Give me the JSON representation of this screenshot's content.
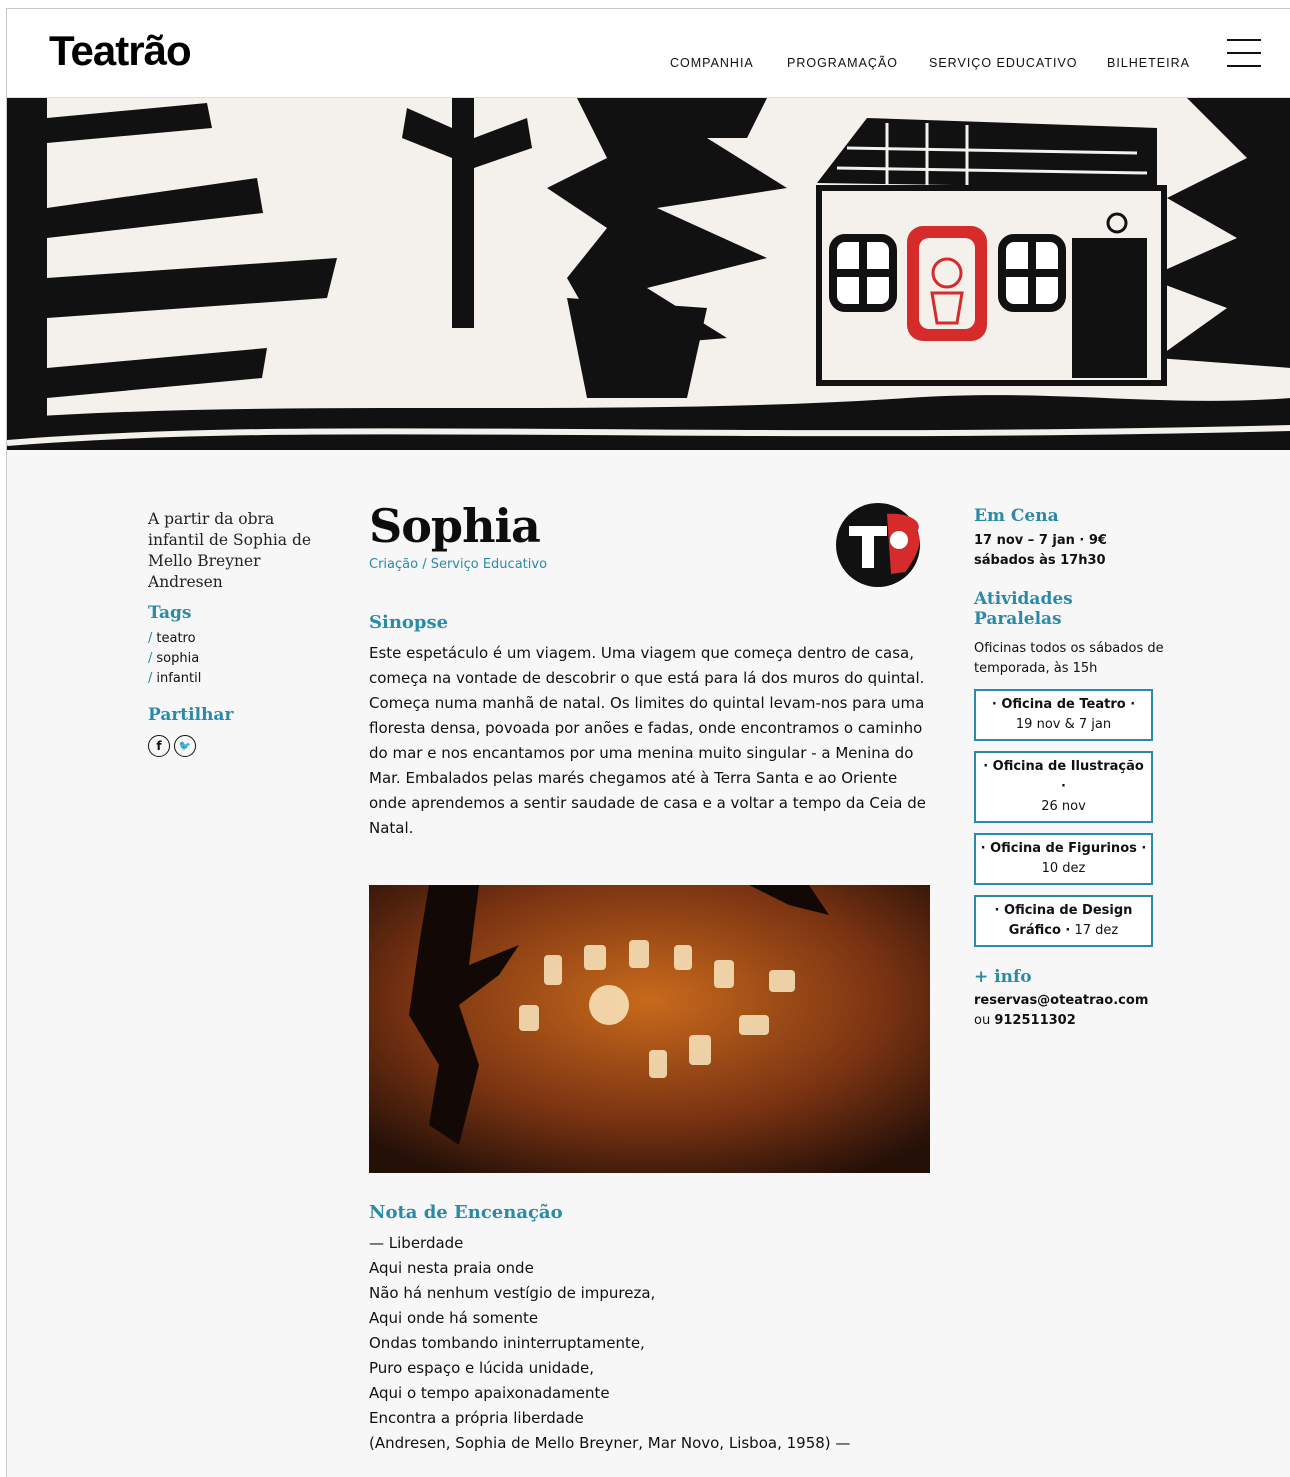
{
  "header": {
    "logo": "Teatrão",
    "nav": [
      {
        "label": "COMPANHIA"
      },
      {
        "label": "PROGRAMAÇÃO"
      },
      {
        "label": "SERVIÇO EDUCATIVO"
      },
      {
        "label": "BILHETEIRA"
      }
    ]
  },
  "left": {
    "subtitle": "A partir da obra infantil de Sophia de Mello Breyner Andresen",
    "tags_heading": "Tags",
    "tags": [
      "teatro",
      "sophia",
      "infantil"
    ],
    "share_heading": "Partilhar",
    "share": [
      {
        "icon": "facebook-icon",
        "glyph": "f"
      },
      {
        "icon": "twitter-icon",
        "glyph": "🐦"
      }
    ]
  },
  "main": {
    "title": "Sophia",
    "category": "Criação / Serviço Educativo",
    "synopsis_heading": "Sinopse",
    "synopsis": "Este espetáculo é um viagem. Uma viagem que começa dentro de casa, começa na vontade de descobrir o que está para lá dos muros do quintal. Começa numa manhã de natal. Os limites do quintal levam-nos para uma floresta densa, povoada por anões e fadas, onde encontramos o caminho do mar e nos encantamos por uma menina muito singular - a Menina do Mar. Embalados pelas marés chegamos até à Terra Santa e ao Oriente onde aprendemos a sentir saudade de casa e a voltar a tempo da Ceia de Natal.",
    "note_heading": "Nota de Encenação",
    "poem": [
      "— Liberdade",
      "Aqui nesta praia onde",
      "Não há nenhum vestígio de impureza,",
      "Aqui onde há somente",
      "Ondas tombando ininterruptamente,",
      "Puro espaço e lúcida unidade,",
      "Aqui o tempo apaixonadamente",
      "Encontra a própria liberdade",
      "(Andresen, Sophia de Mello Breyner, Mar Novo, Lisboa, 1958) —"
    ]
  },
  "right": {
    "em_cena_heading": "Em Cena",
    "dates_line1": "17 nov – 7 jan · 9€",
    "dates_line2": "sábados às 17h30",
    "activities_heading": "Atividades Paralelas",
    "activities_intro": "Oficinas todos os sábados de temporada, às 15h",
    "workshops": [
      {
        "name": "· Oficina de Teatro ·",
        "date": "19 nov & 7 jan"
      },
      {
        "name": "· Oficina de Ilustração ·",
        "date": "26 nov"
      },
      {
        "name": "· Oficina de Figurinos ·",
        "date": "10 dez"
      },
      {
        "name": "· Oficina de Design Gráfico ·",
        "date": "17 dez"
      }
    ],
    "info_heading": "+ info",
    "email": "reservas@oteatrao.com",
    "phone_prefix": "ou",
    "phone": "912511302"
  },
  "colors": {
    "accent": "#2a8aa8",
    "stamp_red": "#d52b2b"
  }
}
